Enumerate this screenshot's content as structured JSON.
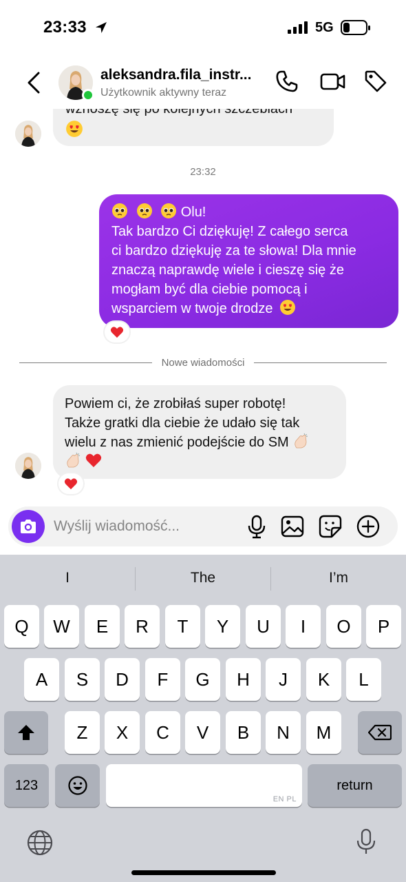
{
  "status_bar": {
    "time": "23:33",
    "network": "5G",
    "icons": [
      "location-arrow-icon",
      "signal-bars-icon",
      "battery-icon"
    ]
  },
  "header": {
    "username": "aleksandra.fila_instr...",
    "status": "Użytkownik aktywny teraz",
    "icons": [
      "back-chevron-icon",
      "phone-icon",
      "video-camera-icon",
      "tag-icon"
    ]
  },
  "chat": {
    "messages": [
      {
        "id": "m1",
        "direction": "incoming",
        "text": "wznoszę się po kolejnych szczeblach",
        "emoji": [
          "heart-eyes"
        ]
      },
      {
        "id": "t1",
        "type": "timestamp",
        "text": "23:32"
      },
      {
        "id": "m2",
        "direction": "outgoing",
        "lines": [
          "Olu!",
          "Tak bardzo Ci dziękuję! Z całego serca",
          "ci bardzo dziękuję za te słowa! Dla mnie",
          "znaczą naprawdę wiele i cieszę się że",
          "mogłam być dla ciebie pomocą i",
          "wsparciem w twoje drodze"
        ],
        "leading_emoji": [
          "pleading-face",
          "pleading-face",
          "pleading-face"
        ],
        "trailing_emoji": [
          "heart-eyes"
        ],
        "reaction": "red-heart"
      },
      {
        "id": "d1",
        "type": "divider",
        "text": "Nowe wiadomości"
      },
      {
        "id": "m3",
        "direction": "incoming",
        "lines": [
          "Powiem ci, że zrobiłaś super robotę!",
          "Także gratki dla ciebie że udało się tak",
          "wielu z nas zmienić podejście do SM"
        ],
        "trailing_emoji": [
          "clapping-hands",
          "clapping-hands",
          "red-heart"
        ],
        "reaction": "red-heart"
      }
    ]
  },
  "composer": {
    "placeholder": "Wyślij wiadomość...",
    "icons": [
      "camera-icon",
      "microphone-icon",
      "image-icon",
      "sticker-icon",
      "plus-circle-icon"
    ],
    "accent_color": "#7a2ff0"
  },
  "keyboard": {
    "suggestions": [
      "I",
      "The",
      "I’m"
    ],
    "rows": [
      [
        "Q",
        "W",
        "E",
        "R",
        "T",
        "Y",
        "U",
        "I",
        "O",
        "P"
      ],
      [
        "A",
        "S",
        "D",
        "F",
        "G",
        "H",
        "J",
        "K",
        "L"
      ],
      [
        "Z",
        "X",
        "C",
        "V",
        "B",
        "N",
        "M"
      ]
    ],
    "numbers_label": "123",
    "return_label": "return",
    "space_languages": "EN PL",
    "icons": [
      "shift-icon",
      "backspace-icon",
      "emoji-face-icon",
      "globe-icon",
      "dictation-mic-icon"
    ]
  },
  "colors": {
    "outgoing_bubble": "#8a2be2",
    "incoming_bubble": "#efefef",
    "online_dot": "#20c53b",
    "keyboard_bg": "#d1d3d9"
  }
}
